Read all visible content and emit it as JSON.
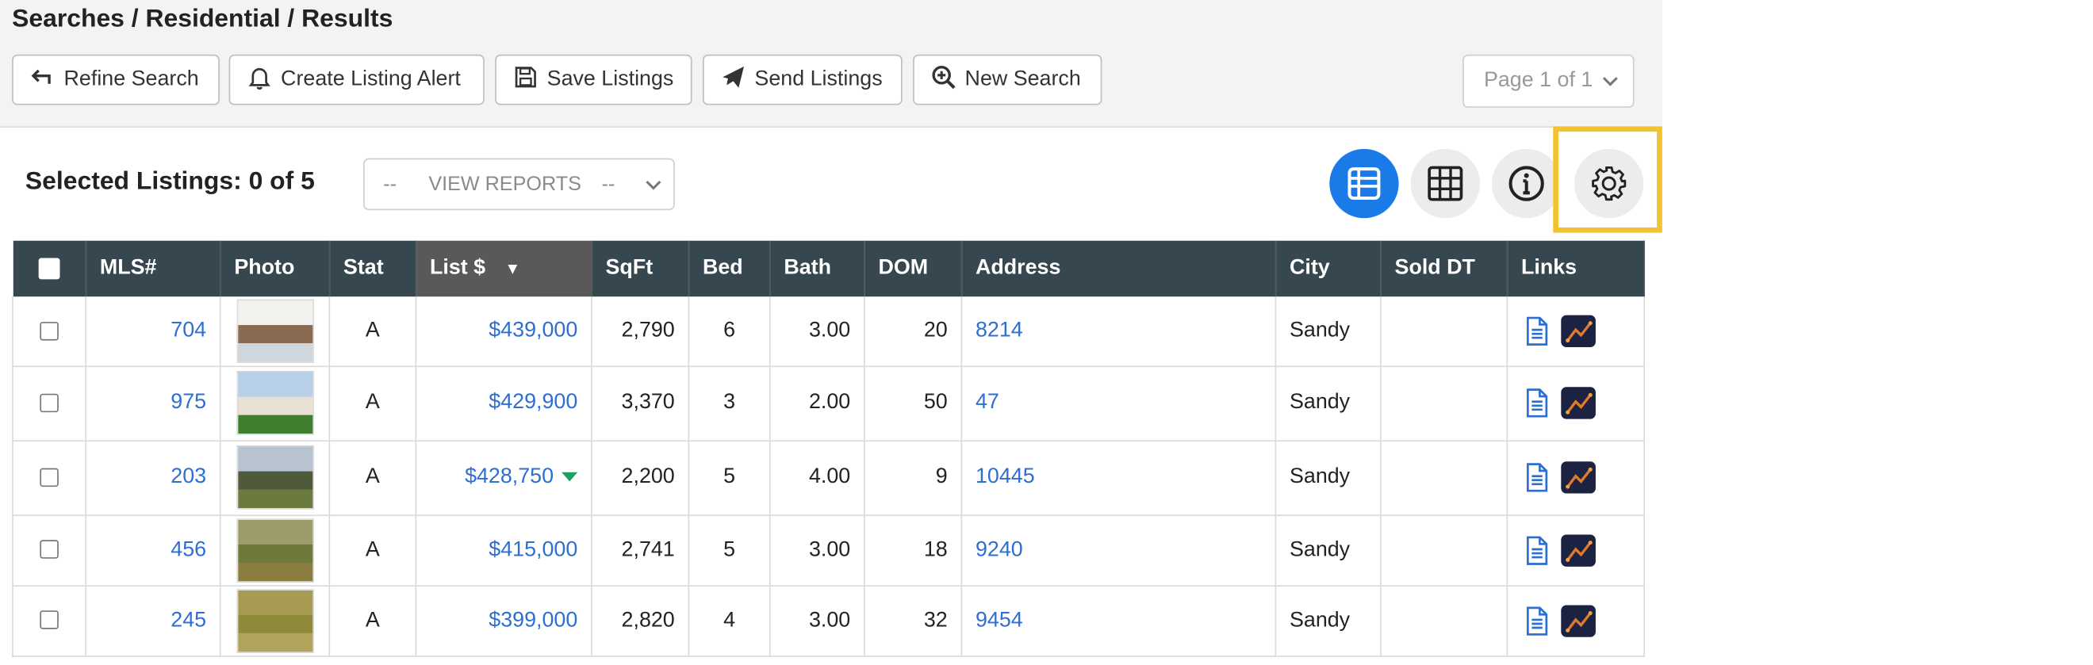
{
  "breadcrumb": "Searches / Residential / Results",
  "toolbar": {
    "refine": "Refine Search",
    "alert": "Create Listing Alert",
    "save": "Save Listings",
    "send": "Send Listings",
    "new_search": "New Search"
  },
  "pager": {
    "label": "Page 1 of 1"
  },
  "selection": {
    "label": "Selected Listings: 0 of 5"
  },
  "reports": {
    "left": "--",
    "label": "VIEW REPORTS",
    "right": "--"
  },
  "view_modes": [
    "list-view-icon",
    "grid-view-icon",
    "info-icon",
    "gear-icon"
  ],
  "colors": {
    "accent": "#1a7be8",
    "header_bg": "#37474f",
    "link": "#2d6fd1",
    "highlight": "#f2c331",
    "price_drop": "#20a060"
  },
  "table": {
    "headers": {
      "mls": "MLS#",
      "photo": "Photo",
      "stat": "Stat",
      "price": "List $",
      "sort_indicator": "▼",
      "sqft": "SqFt",
      "bed": "Bed",
      "bath": "Bath",
      "dom": "DOM",
      "address": "Address",
      "city": "City",
      "sold": "Sold DT",
      "links": "Links"
    },
    "rows": [
      {
        "mls": "704",
        "stat": "A",
        "price": "$439,000",
        "sqft": "2,790",
        "bed": "6",
        "bath": "3.00",
        "dom": "20",
        "address": "8214",
        "city": "Sandy",
        "sold": "",
        "price_drop": false
      },
      {
        "mls": "975",
        "stat": "A",
        "price": "$429,900",
        "sqft": "3,370",
        "bed": "3",
        "bath": "2.00",
        "dom": "50",
        "address": "47",
        "city": "Sandy",
        "sold": "",
        "price_drop": false
      },
      {
        "mls": "203",
        "stat": "A",
        "price": "$428,750",
        "sqft": "2,200",
        "bed": "5",
        "bath": "4.00",
        "dom": "9",
        "address": "10445",
        "city": "Sandy",
        "sold": "",
        "price_drop": true
      },
      {
        "mls": "456",
        "stat": "A",
        "price": "$415,000",
        "sqft": "2,741",
        "bed": "5",
        "bath": "3.00",
        "dom": "18",
        "address": "9240",
        "city": "Sandy",
        "sold": "",
        "price_drop": false
      },
      {
        "mls": "245",
        "stat": "A",
        "price": "$399,000",
        "sqft": "2,820",
        "bed": "4",
        "bath": "3.00",
        "dom": "32",
        "address": "9454",
        "city": "Sandy",
        "sold": "",
        "price_drop": false
      }
    ]
  }
}
